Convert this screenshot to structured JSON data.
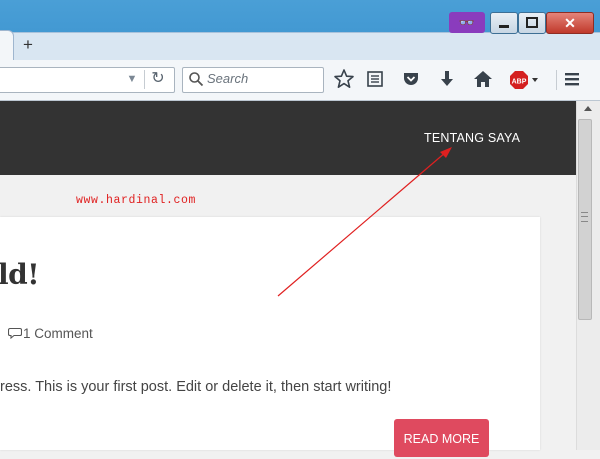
{
  "browser": {
    "new_tab_symbol": "+",
    "private_badge": "👓",
    "close_symbol": "✕",
    "search_placeholder": "Search",
    "url_dropdown_symbol": "▼",
    "reload_symbol": "↻",
    "accent": "#8a3cbd",
    "toolbar_icons": [
      "bookmark-star-icon",
      "reader-list-icon",
      "pocket-icon",
      "downloads-icon",
      "home-icon",
      "adblock-plus-icon",
      "hamburger-menu-icon"
    ]
  },
  "site": {
    "nav_item": "TENTANG SAYA",
    "watermark": "www.hardinal.com",
    "header_color": "#333333"
  },
  "post": {
    "title_fragment": "ld!",
    "comment_count": "1 Comment",
    "excerpt": "ress. This is your first post. Edit or delete it, then start writing!",
    "read_more": "READ MORE",
    "button_color": "#df4a5f"
  },
  "annotation": {
    "arrow_color": "#e02020"
  }
}
